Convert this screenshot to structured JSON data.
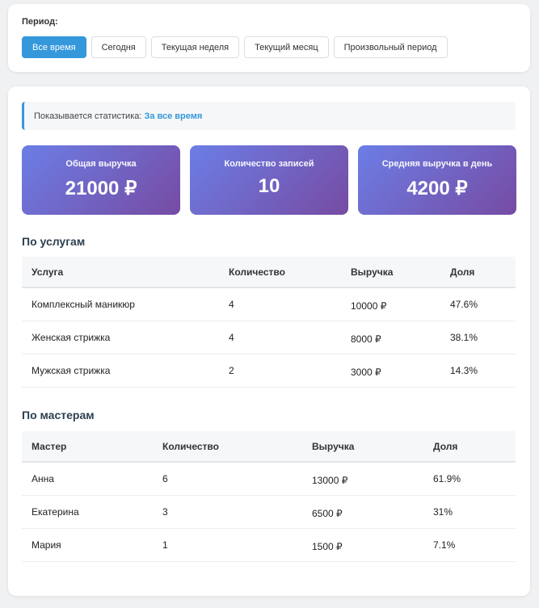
{
  "period": {
    "label": "Период:",
    "buttons": [
      "Все время",
      "Сегодня",
      "Текущая неделя",
      "Текущий месяц",
      "Произвольный период"
    ],
    "active": "Все время"
  },
  "info": {
    "prefix": "Показывается статистика:",
    "value": "За все время"
  },
  "stats": [
    {
      "title": "Общая выручка",
      "value": "21000 ₽"
    },
    {
      "title": "Количество записей",
      "value": "10"
    },
    {
      "title": "Средняя выручка в день",
      "value": "4200 ₽"
    }
  ],
  "services": {
    "title": "По услугам",
    "headers": [
      "Услуга",
      "Количество",
      "Выручка",
      "Доля"
    ],
    "rows": [
      [
        "Комплексный маникюр",
        "4",
        "10000 ₽",
        "47.6%"
      ],
      [
        "Женская стрижка",
        "4",
        "8000 ₽",
        "38.1%"
      ],
      [
        "Мужская стрижка",
        "2",
        "3000 ₽",
        "14.3%"
      ]
    ]
  },
  "masters": {
    "title": "По мастерам",
    "headers": [
      "Мастер",
      "Количество",
      "Выручка",
      "Доля"
    ],
    "rows": [
      [
        "Анна",
        "6",
        "13000 ₽",
        "61.9%"
      ],
      [
        "Екатерина",
        "3",
        "6500 ₽",
        "31%"
      ],
      [
        "Мария",
        "1",
        "1500 ₽",
        "7.1%"
      ]
    ]
  },
  "colors": {
    "accent": "#3498db",
    "gradient_start": "#6c7ee6",
    "gradient_end": "#764ba2"
  }
}
